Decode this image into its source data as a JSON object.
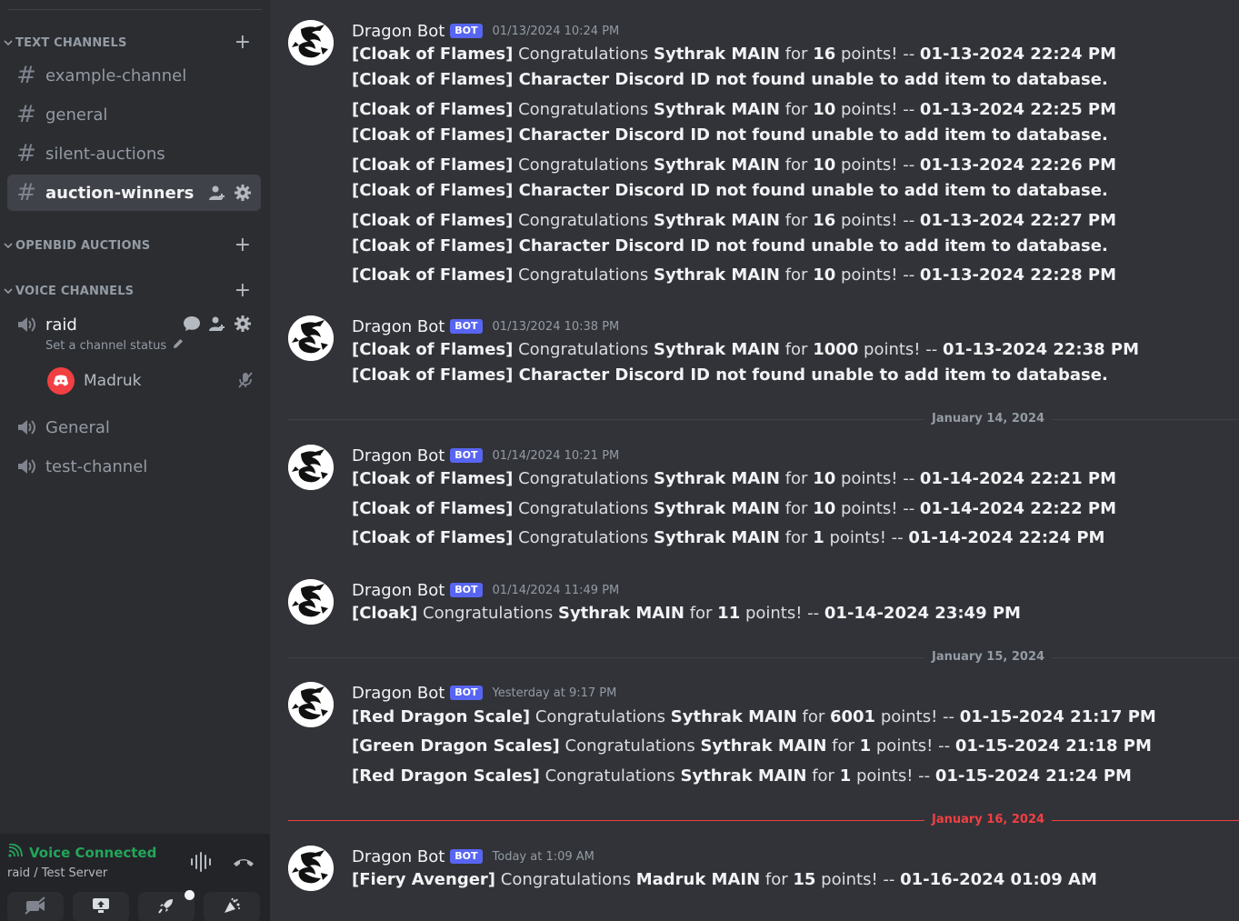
{
  "sidebar": {
    "text_channels_label": "TEXT CHANNELS",
    "openbid_label": "OPENBID AUCTIONS",
    "voice_channels_label": "VOICE CHANNELS",
    "text_channels": [
      "example-channel",
      "general",
      "silent-auctions",
      "auction-winners"
    ],
    "active_channel": "auction-winners",
    "voice_channels": {
      "raid": "raid",
      "raid_status_placeholder": "Set a channel status",
      "raid_user": "Madruk",
      "general": "General",
      "test": "test-channel"
    }
  },
  "voice_panel": {
    "status": "Voice Connected",
    "location": "raid / Test Server"
  },
  "messages": [
    {
      "author": "Dragon Bot",
      "tag": "BOT",
      "timestamp": "01/13/2024 10:24 PM",
      "lines": [
        {
          "item": "[Cloak of Flames]",
          "t1": " Congratulations ",
          "name": "Sythrak MAIN",
          "t2": " for ",
          "pts": "16",
          "t3": " points! -- ",
          "date": "01-13-2024 22:24 PM"
        },
        {
          "err": "[Cloak of Flames] Character Discord ID not found unable to add item to database."
        },
        {
          "item": "[Cloak of Flames]",
          "t1": " Congratulations ",
          "name": "Sythrak MAIN",
          "t2": " for ",
          "pts": "10",
          "t3": " points! -- ",
          "date": "01-13-2024 22:25 PM"
        },
        {
          "err": "[Cloak of Flames] Character Discord ID not found unable to add item to database."
        },
        {
          "item": "[Cloak of Flames]",
          "t1": " Congratulations ",
          "name": "Sythrak MAIN",
          "t2": " for ",
          "pts": "10",
          "t3": " points! -- ",
          "date": "01-13-2024 22:26 PM"
        },
        {
          "err": "[Cloak of Flames] Character Discord ID not found unable to add item to database."
        },
        {
          "item": "[Cloak of Flames]",
          "t1": " Congratulations ",
          "name": "Sythrak MAIN",
          "t2": " for ",
          "pts": "16",
          "t3": " points! -- ",
          "date": "01-13-2024 22:27 PM"
        },
        {
          "err": "[Cloak of Flames] Character Discord ID not found unable to add item to database."
        },
        {
          "item": "[Cloak of Flames]",
          "t1": " Congratulations ",
          "name": "Sythrak MAIN",
          "t2": " for ",
          "pts": "10",
          "t3": " points! -- ",
          "date": "01-13-2024 22:28 PM"
        }
      ]
    },
    {
      "author": "Dragon Bot",
      "tag": "BOT",
      "timestamp": "01/13/2024 10:38 PM",
      "lines": [
        {
          "item": "[Cloak of Flames]",
          "t1": " Congratulations ",
          "name": "Sythrak MAIN",
          "t2": " for ",
          "pts": "1000",
          "t3": " points! -- ",
          "date": "01-13-2024 22:38 PM"
        },
        {
          "err": "[Cloak of Flames] Character Discord ID not found unable to add item to database."
        }
      ]
    },
    {
      "author": "Dragon Bot",
      "tag": "BOT",
      "timestamp": "01/14/2024 10:21 PM",
      "lines": [
        {
          "item": "[Cloak of Flames]",
          "t1": " Congratulations ",
          "name": "Sythrak MAIN",
          "t2": " for ",
          "pts": "10",
          "t3": " points! -- ",
          "date": "01-14-2024 22:21 PM"
        },
        {
          "item": "[Cloak of Flames]",
          "t1": " Congratulations ",
          "name": "Sythrak MAIN",
          "t2": " for ",
          "pts": "10",
          "t3": " points! -- ",
          "date": "01-14-2024 22:22 PM"
        },
        {
          "item": "[Cloak of Flames]",
          "t1": " Congratulations ",
          "name": "Sythrak MAIN",
          "t2": " for ",
          "pts": "1",
          "t3": " points! -- ",
          "date": "01-14-2024 22:24 PM"
        }
      ]
    },
    {
      "author": "Dragon Bot",
      "tag": "BOT",
      "timestamp": "01/14/2024 11:49 PM",
      "lines": [
        {
          "item": "[Cloak]",
          "t1": " Congratulations ",
          "name": "Sythrak MAIN",
          "t2": " for ",
          "pts": "11",
          "t3": " points! -- ",
          "date": "01-14-2024 23:49 PM"
        }
      ]
    },
    {
      "author": "Dragon Bot",
      "tag": "BOT",
      "timestamp": "Yesterday at 9:17 PM",
      "lines": [
        {
          "item": "[Red Dragon Scale]",
          "t1": " Congratulations ",
          "name": "Sythrak MAIN",
          "t2": " for ",
          "pts": "6001",
          "t3": " points! -- ",
          "date": "01-15-2024 21:17 PM"
        },
        {
          "item": "[Green Dragon Scales]",
          "t1": " Congratulations ",
          "name": "Sythrak MAIN",
          "t2": " for ",
          "pts": "1",
          "t3": " points! -- ",
          "date": "01-15-2024 21:18 PM"
        },
        {
          "item": "[Red Dragon Scales]",
          "t1": " Congratulations ",
          "name": "Sythrak MAIN",
          "t2": " for ",
          "pts": "1",
          "t3": " points! -- ",
          "date": "01-15-2024 21:24 PM"
        }
      ]
    },
    {
      "author": "Dragon Bot",
      "tag": "BOT",
      "timestamp": "Today at 1:09 AM",
      "lines": [
        {
          "item": "[Fiery Avenger]",
          "t1": " Congratulations ",
          "name": "Madruk MAIN",
          "t2": " for ",
          "pts": "15",
          "t3": " points! -- ",
          "date": "01-16-2024 01:09 AM"
        }
      ]
    }
  ],
  "dividers": [
    "January 14, 2024",
    "January 15, 2024",
    "January 16, 2024"
  ],
  "colors": {
    "sidebar_bg": "#2b2d31",
    "chat_bg": "#313338",
    "bot_tag": "#5865f2",
    "voice_connected": "#23a55a",
    "new_divider": "#f23f42"
  }
}
